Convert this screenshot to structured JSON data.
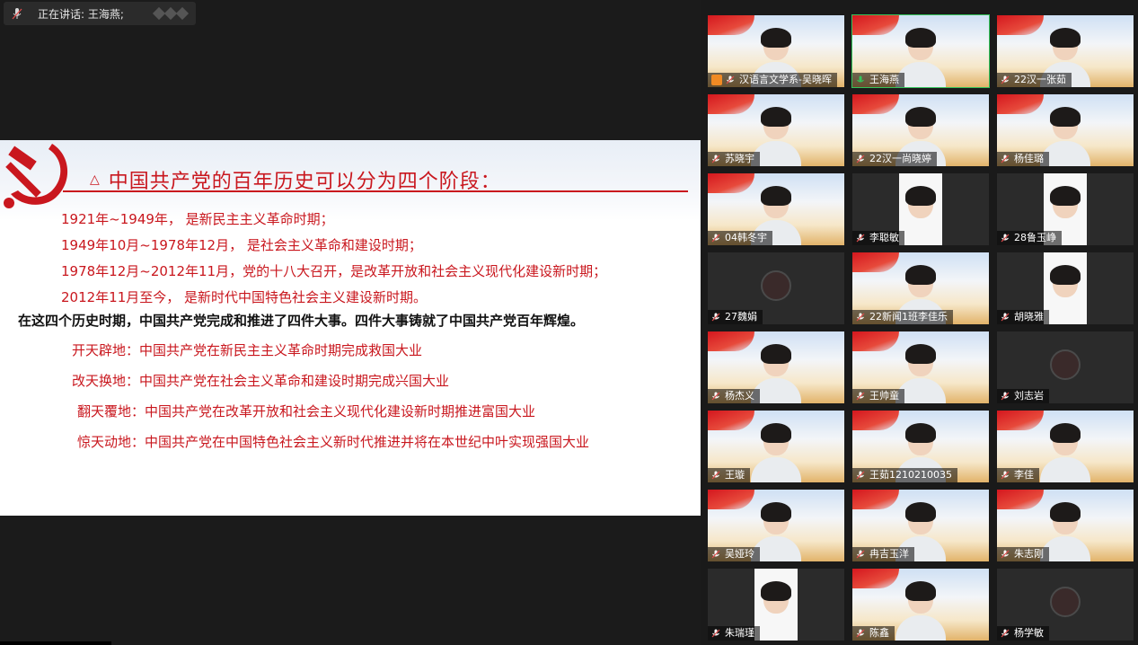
{
  "speaking": {
    "text": "正在讲话: 王海燕;"
  },
  "slide": {
    "title": "中国共产党的百年历史可以分为四个阶段：",
    "periods": [
      "1921年~1949年， 是新民主主义革命时期；",
      "1949年10月~1978年12月， 是社会主义革命和建设时期；",
      "1978年12月~2012年11月，党的十八大召开，是改革开放和社会主义现代化建设新时期；",
      "2012年11月至今， 是新时代中国特色社会主义建设新时期。"
    ],
    "summary": "在这四个历史时期，中国共产党完成和推进了四件大事。四件大事铸就了中国共产党百年辉煌。",
    "feats": [
      "开天辟地：中国共产党在新民主主义革命时期完成救国大业",
      "改天换地：中国共产党在社会主义革命和建设时期完成兴国大业",
      "翻天覆地：中国共产党在改革开放和社会主义现代化建设新时期推进富国大业",
      "惊天动地：中国共产党在中国特色社会主义新时代推进并将在本世纪中叶实现强国大业"
    ]
  },
  "participants": [
    {
      "name": "汉语言文学系-吴晓晖"
    },
    {
      "name": "王海燕"
    },
    {
      "name": "22汉一张茹"
    },
    {
      "name": "苏晓宇"
    },
    {
      "name": "22汉一尚晓婷"
    },
    {
      "name": "杨佳璐"
    },
    {
      "name": "04韩冬宇"
    },
    {
      "name": "李聪敏"
    },
    {
      "name": "28鲁玉峥"
    },
    {
      "name": "27魏娟"
    },
    {
      "name": "22新闻1班李佳乐"
    },
    {
      "name": "胡晓雅"
    },
    {
      "name": "杨杰义"
    },
    {
      "name": "王帅童"
    },
    {
      "name": "刘志岩"
    },
    {
      "name": "王璇"
    },
    {
      "name": "王茹1210210035"
    },
    {
      "name": "李佳"
    },
    {
      "name": "吴娅玲"
    },
    {
      "name": "冉吉玉洋"
    },
    {
      "name": "朱志刚"
    },
    {
      "name": "朱瑞瑾"
    },
    {
      "name": "陈鑫"
    },
    {
      "name": "杨学敏"
    }
  ],
  "colors": {
    "party_red": "#c9171e",
    "active_border": "#33c35a"
  }
}
